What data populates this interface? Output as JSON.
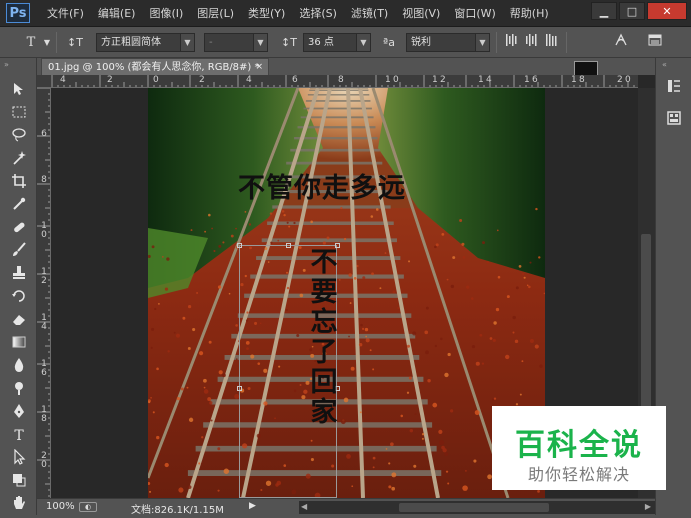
{
  "app": {
    "logo": "Ps"
  },
  "menu": [
    "文件(F)",
    "编辑(E)",
    "图像(I)",
    "图层(L)",
    "类型(Y)",
    "选择(S)",
    "滤镜(T)",
    "视图(V)",
    "窗口(W)",
    "帮助(H)"
  ],
  "window_controls": {
    "minimize": "▁",
    "maximize": "□",
    "close": "✕"
  },
  "options": {
    "tool_glyph": "T",
    "orient_glyph": "↕T",
    "font_family": "方正粗圆简体",
    "font_style": "-",
    "size_glyph": "↕T",
    "font_size": "36 点",
    "aa_glyph": "ªa",
    "antialias": "锐利",
    "color_swatch": "#111111"
  },
  "document": {
    "tab_title": "01.jpg @ 100% (都会有人思念你, RGB/8#) *",
    "tab_close": "×",
    "ruler_top": [
      "4",
      "2",
      "0",
      "2",
      "4",
      "6",
      "8",
      "1",
      "0",
      "1",
      "2",
      "1",
      "4",
      "1",
      "6",
      "1",
      "8",
      "2",
      "0",
      "2",
      "2"
    ],
    "ruler_left": [
      "6",
      "8",
      "1 0",
      "1 2",
      "1 4",
      "1 6",
      "1 8",
      "2 0"
    ],
    "text_horizontal": "不管你走多远",
    "text_vertical": "不要忘了回家"
  },
  "status": {
    "zoom": "100%",
    "doc_info": "文档:826.1K/1.15M"
  },
  "watermark": {
    "title": "百科全说",
    "subtitle": "助你轻松解决"
  },
  "colors": {
    "accent": "#1bb34b",
    "ps_blue": "#4b8bd6"
  }
}
